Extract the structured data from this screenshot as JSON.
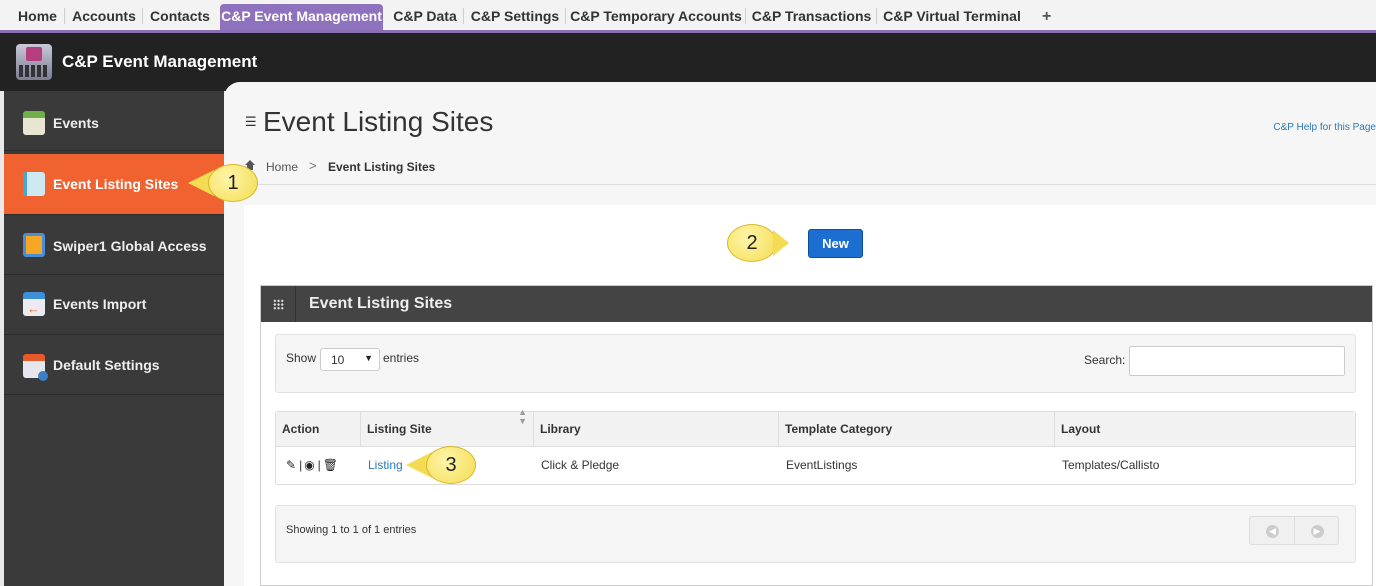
{
  "tabs": [
    {
      "label": "Home"
    },
    {
      "label": "Accounts"
    },
    {
      "label": "Contacts"
    },
    {
      "label": "C&P Event Management"
    },
    {
      "label": "C&P Data"
    },
    {
      "label": "C&P Settings"
    },
    {
      "label": "C&P Temporary Accounts"
    },
    {
      "label": "C&P Transactions"
    },
    {
      "label": "C&P Virtual Terminal"
    }
  ],
  "tab_plus": "+",
  "app_title": "C&P Event Management",
  "sidebar": {
    "items": [
      {
        "label": "Events",
        "icon": "calendar-icon"
      },
      {
        "label": "Event Listing Sites",
        "icon": "document-icon"
      },
      {
        "label": "Swiper1 Global Access",
        "icon": "swiper-icon"
      },
      {
        "label": "Events Import",
        "icon": "import-icon"
      },
      {
        "label": "Default Settings",
        "icon": "settings-icon"
      }
    ],
    "active_color": "#f0622f"
  },
  "page": {
    "title": "Event Listing Sites",
    "help_link": "C&P Help for this Page",
    "breadcrumb": {
      "home": "Home",
      "separator": ">",
      "current": "Event Listing Sites"
    }
  },
  "new_button": "New",
  "widget": {
    "title": "Event Listing Sites",
    "show_label": "Show",
    "page_length": "10",
    "entries_label": "entries",
    "search_label": "Search:",
    "search_value": "",
    "columns": [
      "Action",
      "Listing Site",
      "Library",
      "Template Category",
      "Layout"
    ],
    "rows": [
      {
        "listing_site": "Listing",
        "library": "Click & Pledge",
        "template_category": "EventListings",
        "layout": "Templates/Callisto"
      }
    ],
    "info": "Showing 1 to 1 of 1 entries"
  },
  "callouts": {
    "one": "1",
    "two": "2",
    "three": "3"
  },
  "colors": {
    "accent": "#8f72bd",
    "button": "#1c6fd1",
    "link": "#2a7ab8"
  }
}
